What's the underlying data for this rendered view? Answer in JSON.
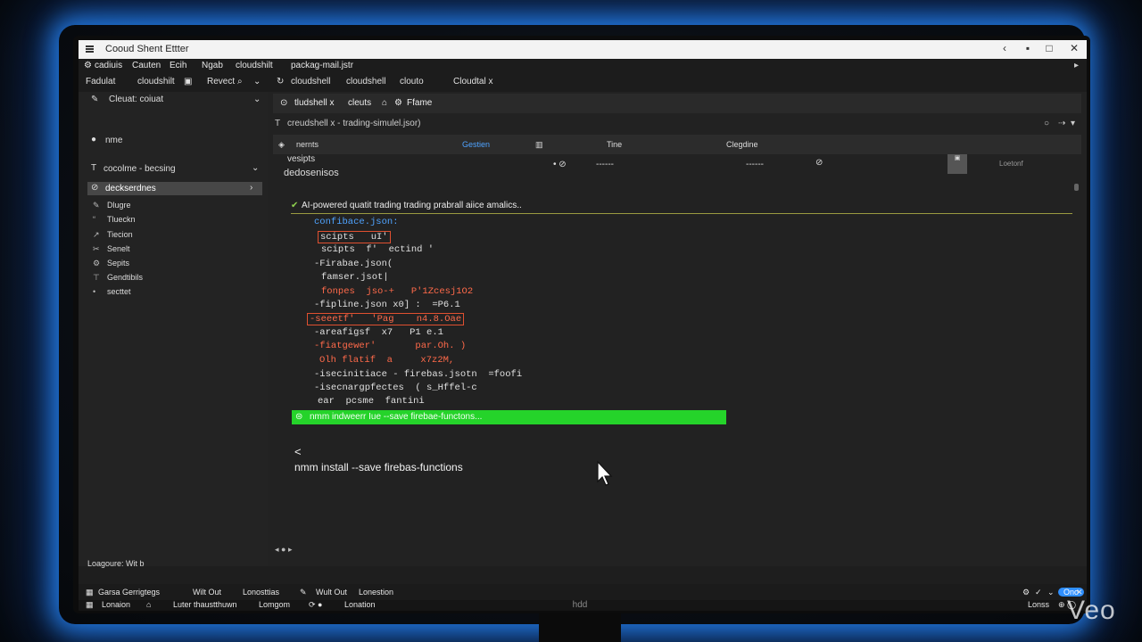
{
  "window": {
    "title": "Cooud Shent Ettter",
    "watermark": "Veo",
    "monitor_brand": "hdd"
  },
  "menu": [
    "cadiuis",
    "Cauten",
    "Ecih",
    "Ngab",
    "cloudshilt",
    "packag-mail.jstr"
  ],
  "toolbar": {
    "items": [
      "Fadulat",
      "cloudshilt",
      "Revect",
      "cloudshell",
      "cloudshell",
      "clouto",
      "Cloudtal x"
    ]
  },
  "sidebar": {
    "header": "Cleuat: coiuat",
    "items": [
      "nme",
      "cocolme - becsing",
      "deckserdnes"
    ],
    "subitems": [
      "Dlugre",
      "Tlueckn",
      "Tiecion",
      "Senelt",
      "Sepits",
      "Gendtibils",
      "secttet"
    ]
  },
  "editor": {
    "tabs": [
      "tludshell x",
      "cleuts",
      "Ffame"
    ],
    "path": "creudshell x - trading-simulel.jsor)",
    "table": {
      "headers": [
        "nernts",
        "Gestien",
        "Tine",
        "Clegdine"
      ],
      "row_name": "vesipts",
      "row_desc": "dedosenisos",
      "cells": [
        "------",
        "------",
        "Loetonf"
      ]
    },
    "ai_header": "AI-powered quatit trading trading prabrall aiice amalics..",
    "code_lines": [
      "confibace.json:",
      "scipts   uI'",
      "scipts  f'  ectind '",
      "-Firabae.json(",
      "famser.jsot|",
      "fonpes  jso-+   P'1Zcesj1O2",
      "-fipline.json x0] :  =P6.1",
      "-seeetf'   'Pag    n4.8.Oae",
      "-areafigsf  x7   P1 e.1",
      "-fiatgewer'       par.Oh. )",
      "Olh flatif  a     x7z2M,",
      "-isecinitiace - firebas.jsotn  =foofi",
      "-isecnargpfectes  ( s_Hffel-c",
      "ear  pcsme  fantini"
    ],
    "highlight_command": "nmm indweerr Iue   --save firebae-functons...",
    "prompt": "<",
    "command": "nmm install --save firebas-functions"
  },
  "panel": {
    "label": "Loagoure: Wit b",
    "status_items": [
      "Garsa Gerrigtegs",
      "Wilt Out",
      "Lonosttias",
      "Wult Out",
      "Lonestion"
    ],
    "status_items2": [
      "Lonaion",
      "Luter thaustthuwn",
      "Lomgom",
      "Lonation"
    ],
    "right_label": "Lonss",
    "right_pill": "Ono"
  },
  "colors": {
    "accent_green": "#25d32a",
    "glow": "#288cff",
    "code_orange": "#ff6a4a",
    "code_blue": "#4fa3ff"
  }
}
